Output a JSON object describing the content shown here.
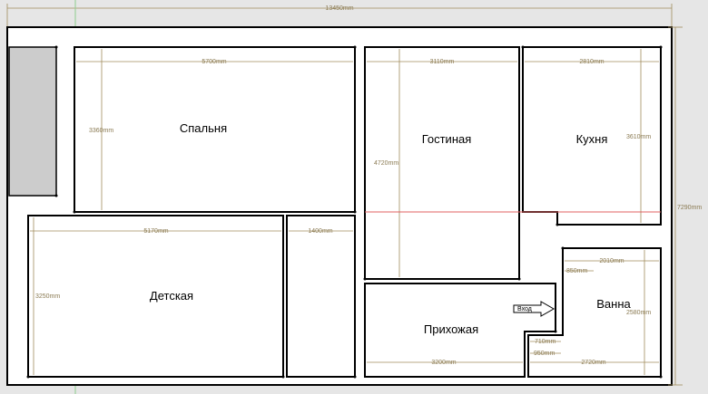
{
  "rooms": {
    "bedroom": "Спальня",
    "living": "Гостиная",
    "kitchen": "Кухня",
    "kids": "Детская",
    "bath": "Ванна",
    "hall": "Прихожая"
  },
  "entrance_label": "Вход",
  "dimensions": {
    "total_width": "13450mm",
    "total_height": "7290mm",
    "bedroom_width": "5700mm",
    "bedroom_height": "3360mm",
    "living_width": "3110mm",
    "living_height": "4720mm",
    "kitchen_width": "2810mm",
    "kitchen_height": "3610mm",
    "kids_width": "5170mm",
    "kids_height": "3250mm",
    "closet_width": "1400mm",
    "bath_width": "2010mm",
    "bath_height": "2580mm",
    "bath_step": "850mm",
    "hall_width": "3200mm",
    "step_710": "710mm",
    "step_950": "950mm",
    "bottom_2720": "2720mm"
  },
  "colors": {
    "background": "#e6e6e6",
    "wall": "#ffffff",
    "line": "#000000",
    "dimension": "#a08c5c",
    "grey_block": "#cccccc",
    "green_axis": "#8fcf8f",
    "red_axis": "#e06060"
  }
}
